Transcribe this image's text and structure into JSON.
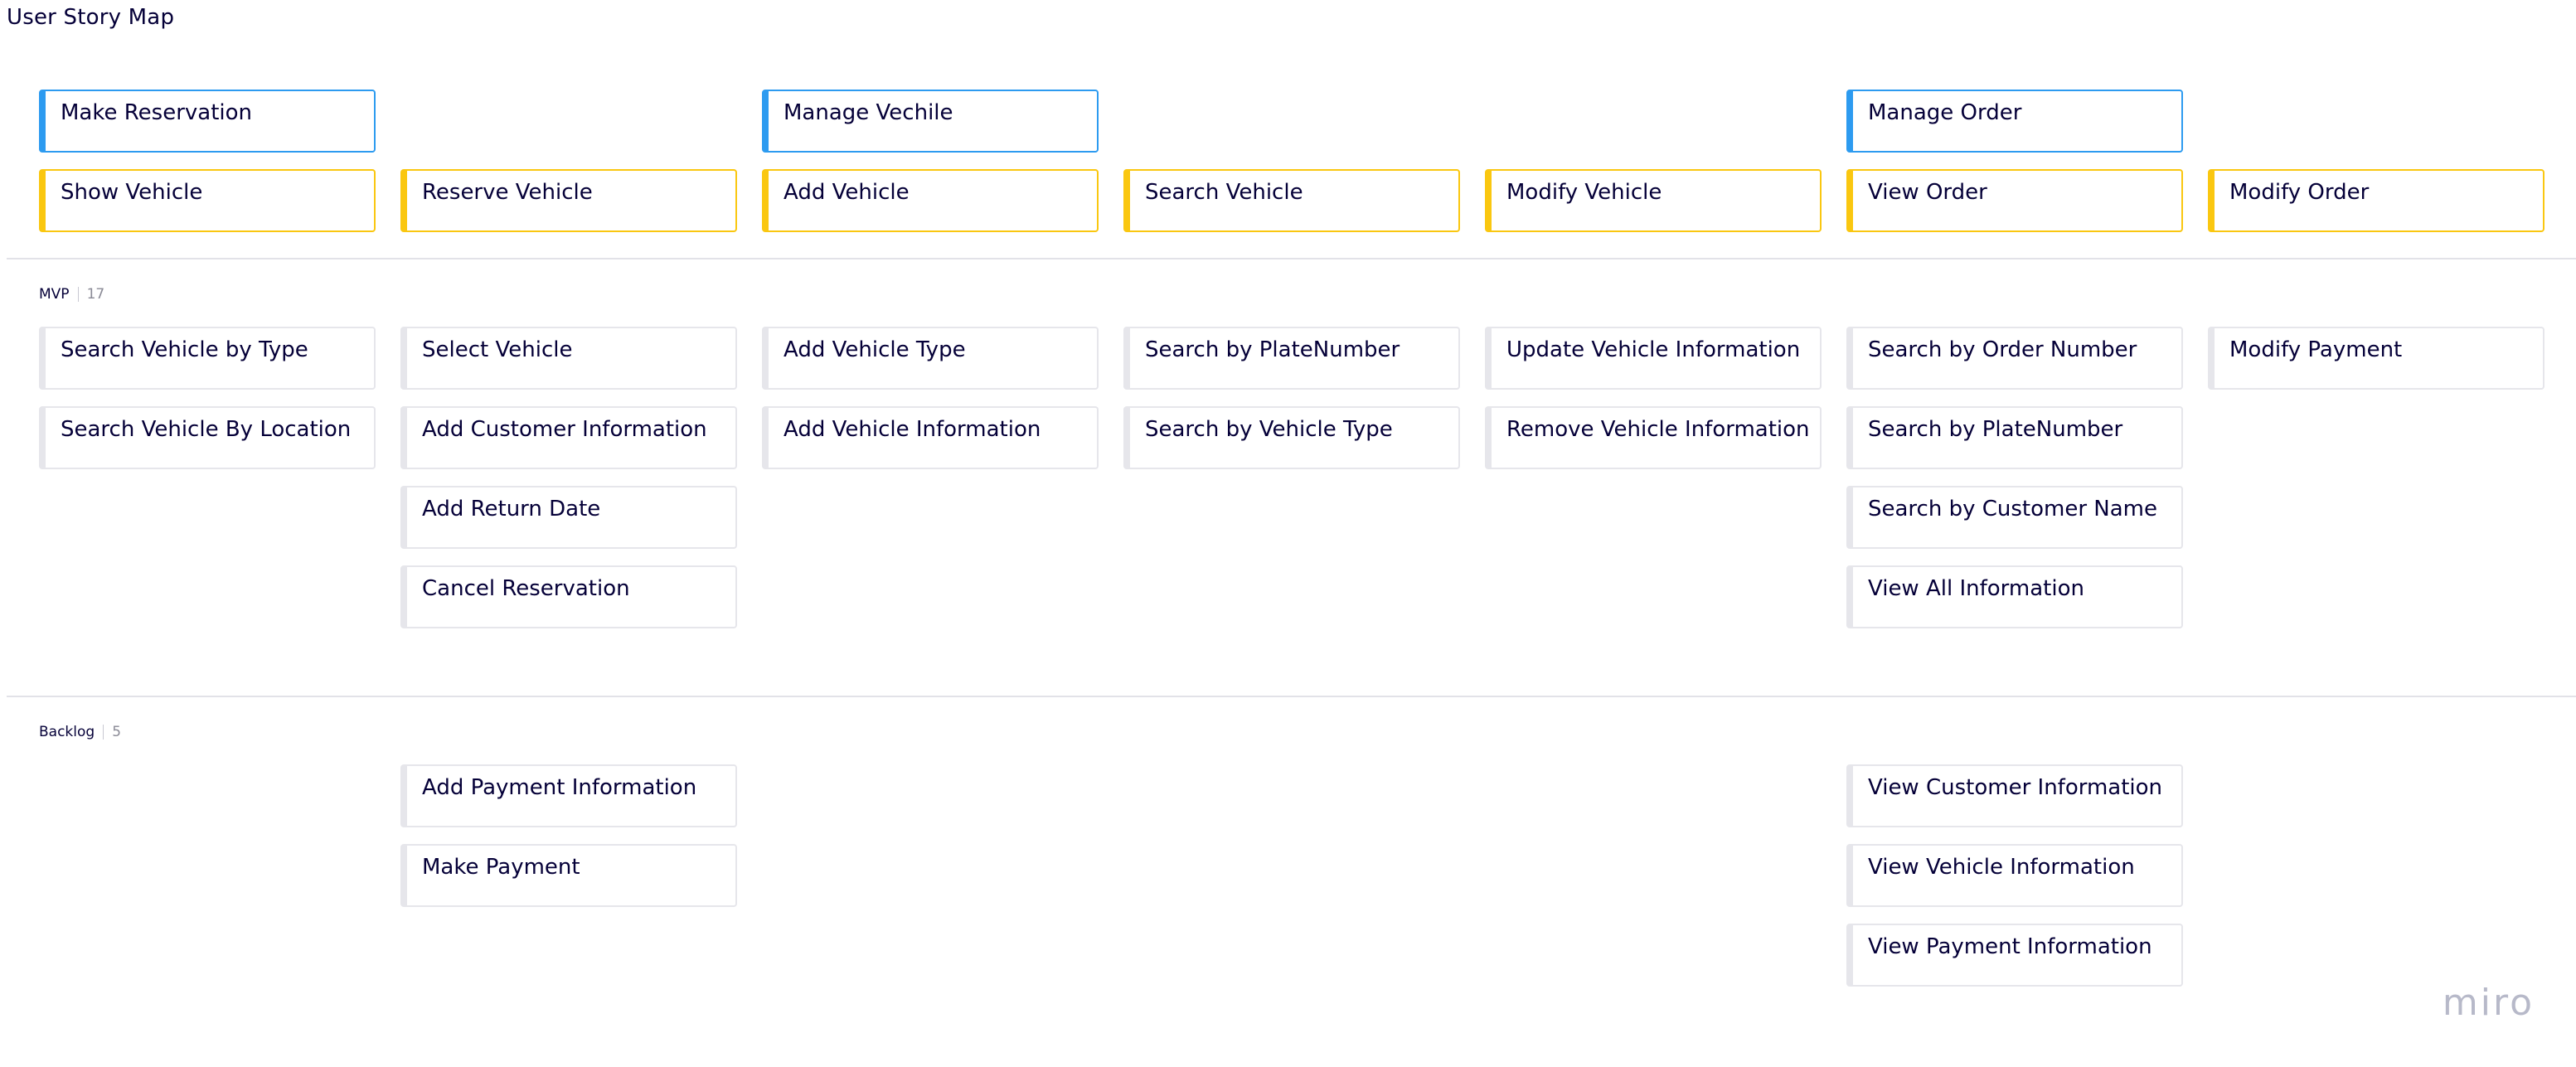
{
  "board": {
    "title": "User Story Map",
    "watermark": "miro"
  },
  "colors": {
    "activity": "#2d9bf0",
    "step": "#fac710",
    "story": "#e6e6eb",
    "divider": "#e2e2e8"
  },
  "activities": [
    "Make Reservation",
    "",
    "Manage Vechile",
    "",
    "",
    "Manage Order",
    ""
  ],
  "steps": [
    "Show Vehicle",
    "Reserve Vehicle",
    "Add Vehicle",
    "Search Vehicle",
    "Modify Vehicle",
    "View Order",
    "Modify Order"
  ],
  "releases": [
    {
      "name": "MVP",
      "count": "17",
      "columns": [
        [
          "Search Vehicle by Type",
          "Search Vehicle By Location"
        ],
        [
          "Select Vehicle",
          "Add Customer Information",
          "Add Return Date",
          "Cancel Reservation"
        ],
        [
          "Add Vehicle Type",
          "Add Vehicle Information"
        ],
        [
          "Search by PlateNumber",
          "Search by Vehicle Type"
        ],
        [
          "Update Vehicle Information",
          "Remove Vehicle Information"
        ],
        [
          "Search by Order Number",
          "Search by PlateNumber",
          "Search by Customer Name",
          "View All Information"
        ],
        [
          "Modify Payment"
        ]
      ]
    },
    {
      "name": "Backlog",
      "count": "5",
      "columns": [
        [],
        [
          "Add Payment Information",
          "Make Payment"
        ],
        [],
        [],
        [],
        [
          "View Customer Information",
          "View Vehicle Information",
          "View Payment Information"
        ],
        []
      ]
    }
  ]
}
